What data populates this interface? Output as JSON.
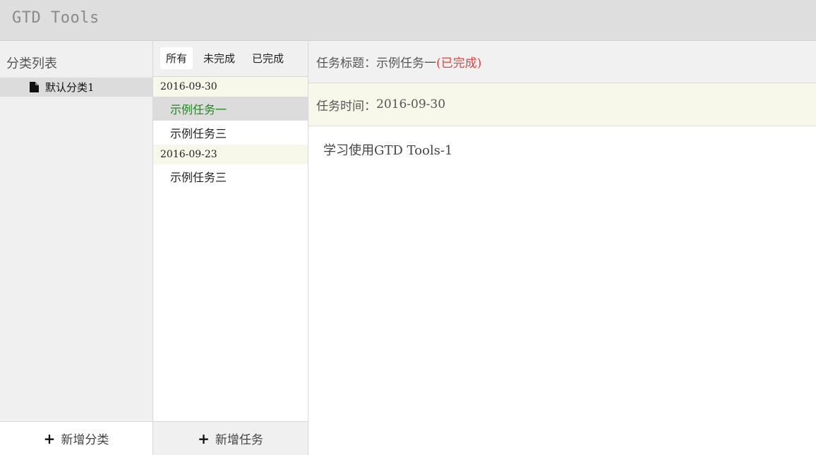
{
  "app": {
    "title": "GTD Tools"
  },
  "categories": {
    "heading": "分类列表",
    "items": [
      {
        "label": "默认分类1",
        "icon": "file-icon"
      }
    ],
    "add_label": "新增分类"
  },
  "tasks": {
    "tabs": [
      "所有",
      "未完成",
      "已完成"
    ],
    "active_tab": "所有",
    "groups": [
      {
        "date": "2016-09-30",
        "items": [
          "示例任务一",
          "示例任务三"
        ]
      },
      {
        "date": "2016-09-23",
        "items": [
          "示例任务三"
        ]
      }
    ],
    "selected_task": "示例任务一",
    "add_label": "新增任务"
  },
  "detail": {
    "title_label": "任务标题：",
    "title_value": "示例任务一",
    "status": "(已完成)",
    "time_label": "任务时间：",
    "time_value": "2016-09-30",
    "content": "学习使用GTD Tools-1"
  },
  "colors": {
    "header_bg": "#dedede",
    "sidebar_bg": "#f0f0f0",
    "date_row_bg": "#f7f7ea",
    "selected_task_text": "#1a8a1a",
    "status_red": "#e8413f"
  }
}
